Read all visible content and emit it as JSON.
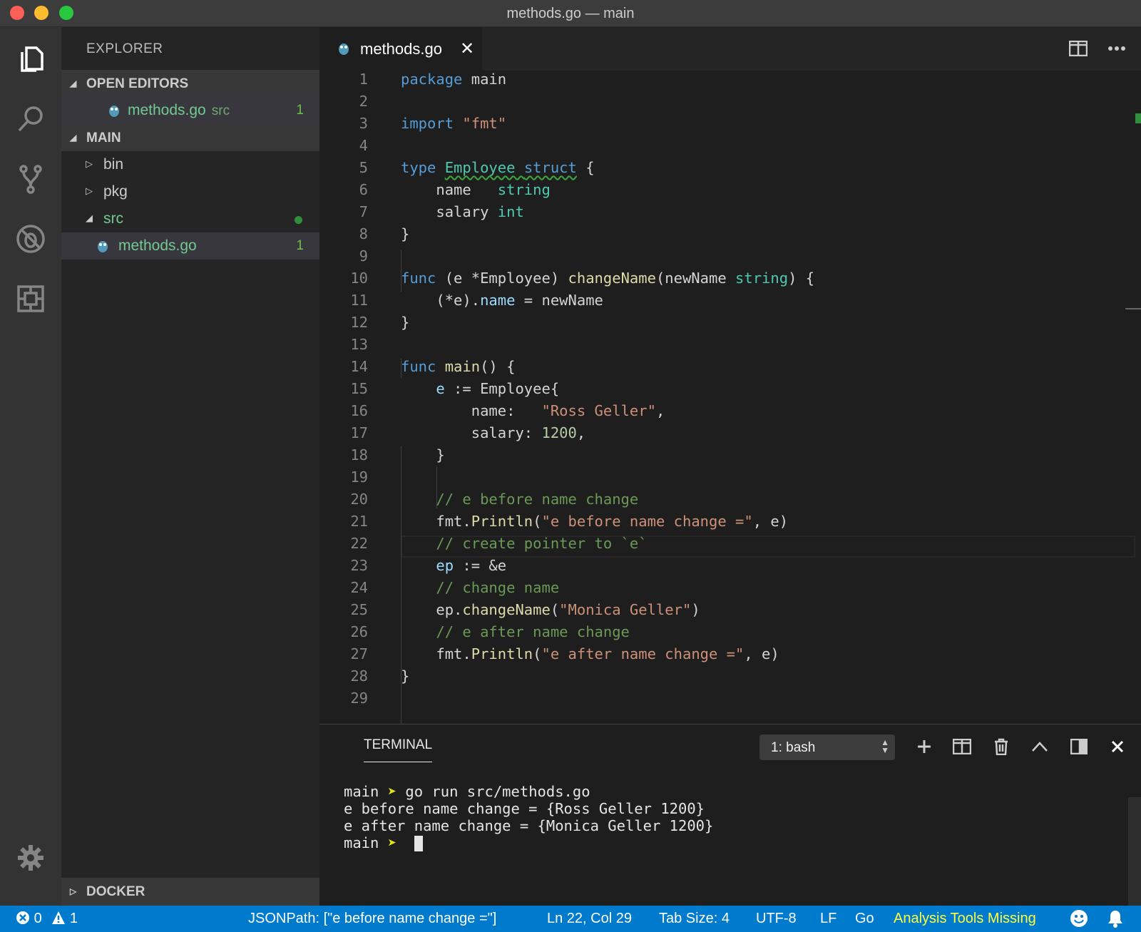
{
  "window": {
    "title": "methods.go — main"
  },
  "sidebar": {
    "title": "EXPLORER",
    "open_editors": {
      "label": "OPEN EDITORS",
      "items": [
        {
          "name": "methods.go",
          "hint": "src",
          "badge": "1"
        }
      ]
    },
    "workspace": {
      "label": "MAIN",
      "items": [
        {
          "name": "bin"
        },
        {
          "name": "pkg"
        },
        {
          "name": "src"
        },
        {
          "name": "methods.go",
          "badge": "1"
        }
      ]
    },
    "docker_label": "DOCKER"
  },
  "editor": {
    "tab": {
      "label": "methods.go",
      "close": "✕"
    },
    "line_numbers": [
      "1",
      "2",
      "3",
      "4",
      "5",
      "6",
      "7",
      "8",
      "9",
      "10",
      "11",
      "12",
      "13",
      "14",
      "15",
      "16",
      "17",
      "18",
      "19",
      "20",
      "21",
      "22",
      "23",
      "24",
      "25",
      "26",
      "27",
      "28",
      "29"
    ],
    "lines": [
      "package main",
      "",
      "import \"fmt\"",
      "",
      "type Employee struct {",
      "    name   string",
      "    salary int",
      "}",
      "",
      "func (e *Employee) changeName(newName string) {",
      "    (*e).name = newName",
      "}",
      "",
      "func main() {",
      "    e := Employee{",
      "        name:   \"Ross Geller\",",
      "        salary: 1200,",
      "    }",
      "",
      "    // e before name change",
      "    fmt.Println(\"e before name change =\", e)",
      "    // create pointer to `e`",
      "    ep := &e",
      "    // change name",
      "    ep.changeName(\"Monica Geller\")",
      "    // e after name change",
      "    fmt.Println(\"e after name change =\", e)",
      "}",
      ""
    ]
  },
  "terminal": {
    "title": "TERMINAL",
    "selected_shell": "1: bash",
    "lines": [
      {
        "prompt": "main",
        "arrow": "➤",
        "text": " go run src/methods.go"
      },
      {
        "text": "e before name change = {Ross Geller 1200}"
      },
      {
        "text": "e after name change = {Monica Geller 1200}"
      },
      {
        "prompt": "main",
        "arrow": "➤",
        "text": " "
      }
    ]
  },
  "statusbar": {
    "errors": "0",
    "warnings": "1",
    "jsonpath": "JSONPath: [\"e before name change =\"]",
    "position": "Ln 22, Col 29",
    "tab_size": "Tab Size: 4",
    "encoding": "UTF-8",
    "eol": "LF",
    "language": "Go",
    "analysis": "Analysis Tools Missing"
  }
}
